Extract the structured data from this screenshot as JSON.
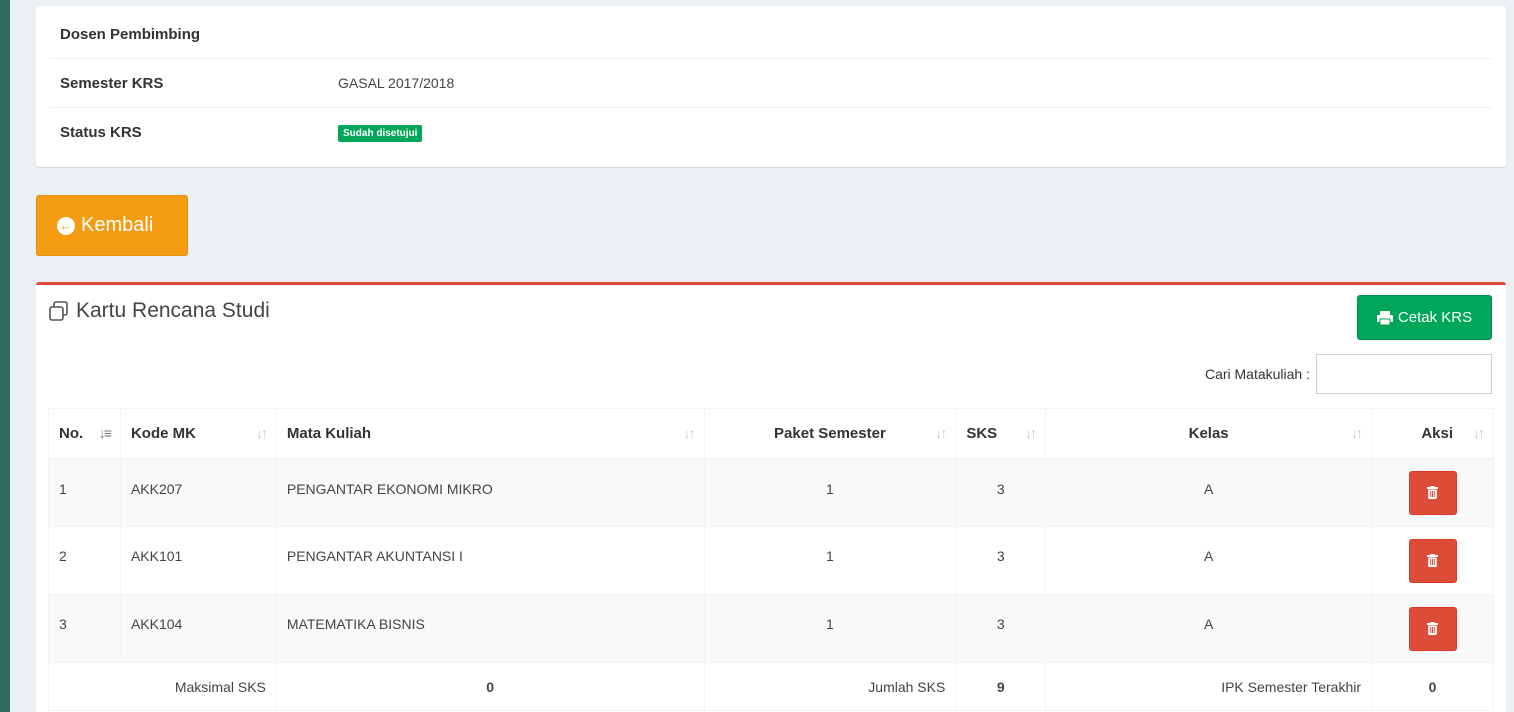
{
  "info": {
    "rows": [
      {
        "label": "Dosen Pembimbing",
        "value": ""
      },
      {
        "label": "Semester KRS",
        "value": "GASAL 2017/2018"
      },
      {
        "label": "Status KRS",
        "badge": "Sudah disetujui"
      }
    ]
  },
  "back_button": {
    "label": "Kembali",
    "icon": "arrow-circle-left-icon"
  },
  "panel": {
    "title": "Kartu Rencana Studi",
    "print_button": "Cetak KRS",
    "search_label": "Cari Matakuliah :",
    "search_value": ""
  },
  "table": {
    "headers": [
      "No.",
      "Kode MK",
      "Mata Kuliah",
      "Paket Semester",
      "SKS",
      "Kelas",
      "Aksi"
    ],
    "rows": [
      {
        "no": "1",
        "kode": "AKK207",
        "mk": "PENGANTAR EKONOMI MIKRO",
        "paket": "1",
        "sks": "3",
        "kelas": "A"
      },
      {
        "no": "2",
        "kode": "AKK101",
        "mk": "PENGANTAR AKUNTANSI I",
        "paket": "1",
        "sks": "3",
        "kelas": "A"
      },
      {
        "no": "3",
        "kode": "AKK104",
        "mk": "MATEMATIKA BISNIS",
        "paket": "1",
        "sks": "3",
        "kelas": "A"
      }
    ],
    "footer": {
      "max_label": "Maksimal SKS",
      "max_value": "0",
      "total_label": "Jumlah SKS",
      "total_value": "9",
      "ipk_label": "IPK Semester Terakhir",
      "ipk_value": "0"
    }
  },
  "colors": {
    "accent_orange": "#f39c12",
    "accent_green": "#00a65a",
    "accent_red": "#dd4b39",
    "sidebar_bg": "#2e6a5e",
    "content_bg": "#ecf0f5"
  }
}
